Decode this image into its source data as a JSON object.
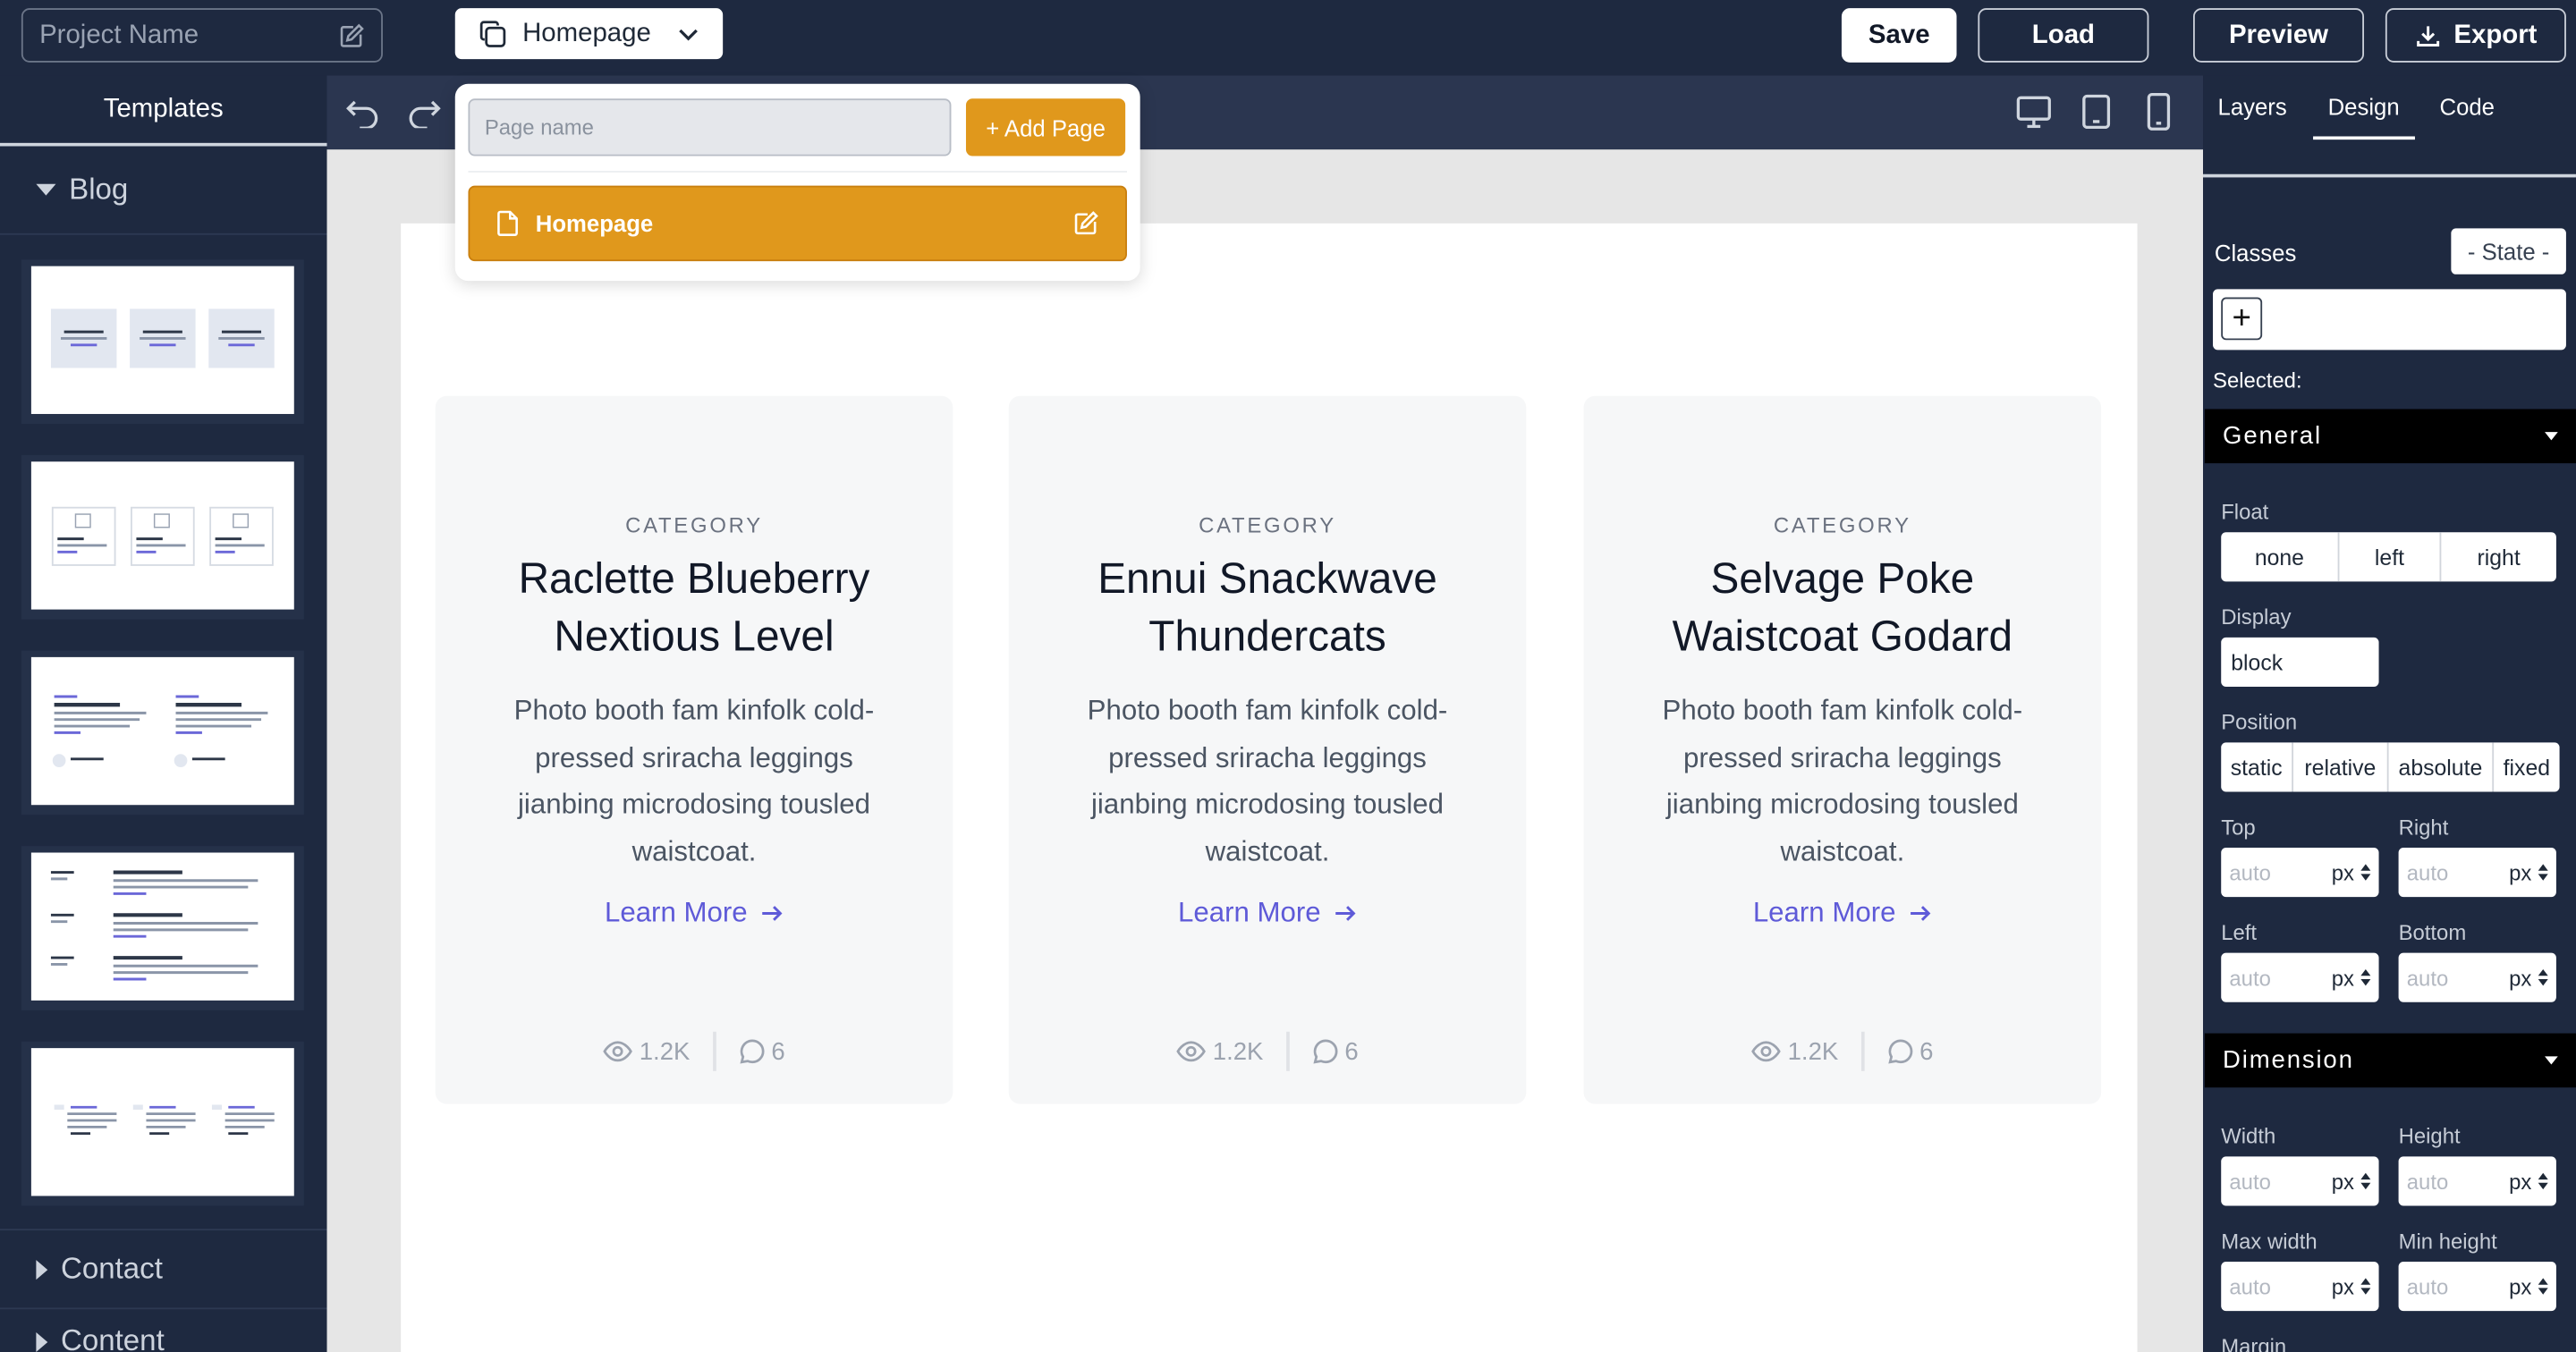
{
  "topbar": {
    "project_placeholder": "Project Name",
    "current_page": "Homepage",
    "save": "Save",
    "load": "Load",
    "preview": "Preview",
    "export": "Export"
  },
  "left": {
    "header": "Templates",
    "categories": [
      {
        "label": "Blog",
        "expanded": true
      },
      {
        "label": "Contact",
        "expanded": false
      },
      {
        "label": "Content",
        "expanded": false
      }
    ]
  },
  "popup": {
    "page_name_placeholder": "Page name",
    "add_page": "+ Add Page",
    "pages": [
      {
        "label": "Homepage"
      }
    ]
  },
  "cards": [
    {
      "category": "CATEGORY",
      "title": "Raclette Blueberry Nextious Level",
      "desc": "Photo booth fam kinfolk cold-pressed sriracha leggings jianbing microdosing tousled waistcoat.",
      "link": "Learn More",
      "views": "1.2K",
      "comments": "6"
    },
    {
      "category": "CATEGORY",
      "title": "Ennui Snackwave Thundercats",
      "desc": "Photo booth fam kinfolk cold-pressed sriracha leggings jianbing microdosing tousled waistcoat.",
      "link": "Learn More",
      "views": "1.2K",
      "comments": "6"
    },
    {
      "category": "CATEGORY",
      "title": "Selvage Poke Waistcoat Godard",
      "desc": "Photo booth fam kinfolk cold-pressed sriracha leggings jianbing microdosing tousled waistcoat.",
      "link": "Learn More",
      "views": "1.2K",
      "comments": "6"
    }
  ],
  "right": {
    "tabs": [
      "Layers",
      "Design",
      "Code"
    ],
    "active_tab": "Design",
    "classes_label": "Classes",
    "state": "- State -",
    "selected_label": "Selected:",
    "general": {
      "title": "General",
      "float_label": "Float",
      "float_options": [
        "none",
        "left",
        "right"
      ],
      "display_label": "Display",
      "display_value": "block",
      "position_label": "Position",
      "position_options": [
        "static",
        "relative",
        "absolute",
        "fixed"
      ],
      "top_label": "Top",
      "right_label": "Right",
      "left_label": "Left",
      "bottom_label": "Bottom",
      "value": "auto",
      "unit": "px"
    },
    "dimension": {
      "title": "Dimension",
      "width_label": "Width",
      "height_label": "Height",
      "maxw_label": "Max width",
      "minh_label": "Min height",
      "margin_label": "Margin",
      "value": "auto",
      "unit": "px"
    }
  },
  "colors": {
    "accent": "#e0981c",
    "link": "#5e5ad8",
    "dark": "#1e2940"
  }
}
